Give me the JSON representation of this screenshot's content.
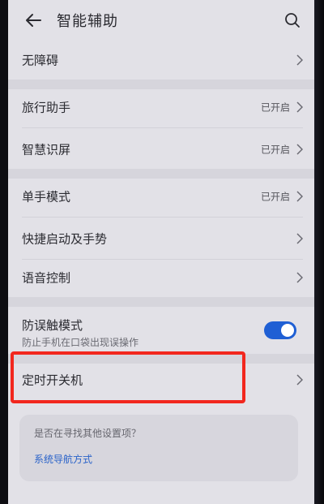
{
  "header": {
    "title": "智能辅助"
  },
  "items": {
    "accessibility": {
      "label": "无障碍"
    },
    "travel_assistant": {
      "label": "旅行助手",
      "status": "已开启"
    },
    "smart_screen": {
      "label": "智慧识屏",
      "status": "已开启"
    },
    "one_hand_mode": {
      "label": "单手模式",
      "status": "已开启"
    },
    "quick_launch": {
      "label": "快捷启动及手势"
    },
    "voice_control": {
      "label": "语音控制"
    },
    "pocket_mode": {
      "label": "防误触模式",
      "description": "防止手机在口袋出现误操作",
      "enabled": true
    },
    "scheduled_power": {
      "label": "定时开关机"
    }
  },
  "suggestion": {
    "question": "是否在寻找其他设置项？",
    "link": "系统导航方式"
  },
  "colors": {
    "accent": "#1f5fd4",
    "highlight": "#f2271e",
    "link": "#2a63c9"
  }
}
